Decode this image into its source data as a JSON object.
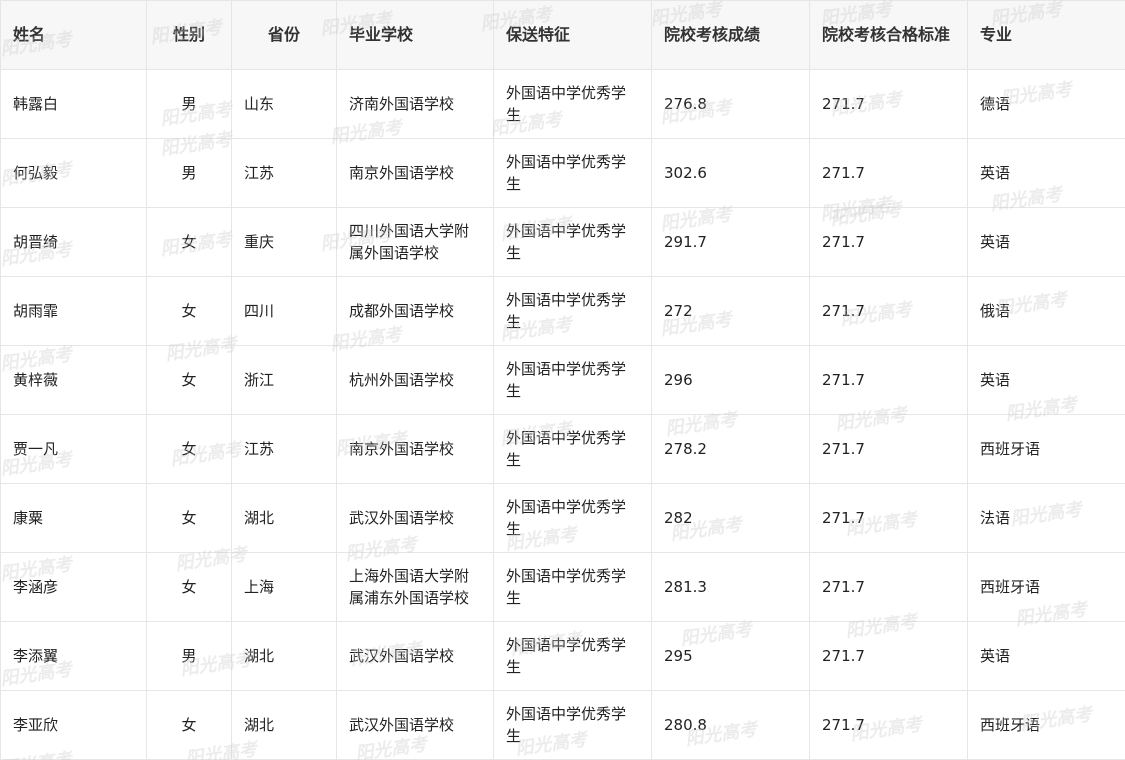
{
  "table": {
    "headers": [
      "姓名",
      "性别",
      "省份",
      "毕业学校",
      "保送特征",
      "院校考核成绩",
      "院校考核合格标准",
      "专业"
    ],
    "rows": [
      [
        "韩露白",
        "男",
        "山东",
        "济南外国语学校",
        "外国语中学优秀学生",
        "276.8",
        "271.7",
        "德语"
      ],
      [
        "何弘毅",
        "男",
        "江苏",
        "南京外国语学校",
        "外国语中学优秀学生",
        "302.6",
        "271.7",
        "英语"
      ],
      [
        "胡晋绮",
        "女",
        "重庆",
        "四川外国语大学附属外国语学校",
        "外国语中学优秀学生",
        "291.7",
        "271.7",
        "英语"
      ],
      [
        "胡雨霏",
        "女",
        "四川",
        "成都外国语学校",
        "外国语中学优秀学生",
        "272",
        "271.7",
        "俄语"
      ],
      [
        "黄梓薇",
        "女",
        "浙江",
        "杭州外国语学校",
        "外国语中学优秀学生",
        "296",
        "271.7",
        "英语"
      ],
      [
        "贾一凡",
        "女",
        "江苏",
        "南京外国语学校",
        "外国语中学优秀学生",
        "278.2",
        "271.7",
        "西班牙语"
      ],
      [
        "康粟",
        "女",
        "湖北",
        "武汉外国语学校",
        "外国语中学优秀学生",
        "282",
        "271.7",
        "法语"
      ],
      [
        "李涵彦",
        "女",
        "上海",
        "上海外国语大学附属浦东外国语学校",
        "外国语中学优秀学生",
        "281.3",
        "271.7",
        "西班牙语"
      ],
      [
        "李添翼",
        "男",
        "湖北",
        "武汉外国语学校",
        "外国语中学优秀学生",
        "295",
        "271.7",
        "英语"
      ],
      [
        "李亚欣",
        "女",
        "湖北",
        "武汉外国语学校",
        "外国语中学优秀学生",
        "280.8",
        "271.7",
        "西班牙语"
      ]
    ]
  },
  "watermark": {
    "text": "阳光高考"
  }
}
